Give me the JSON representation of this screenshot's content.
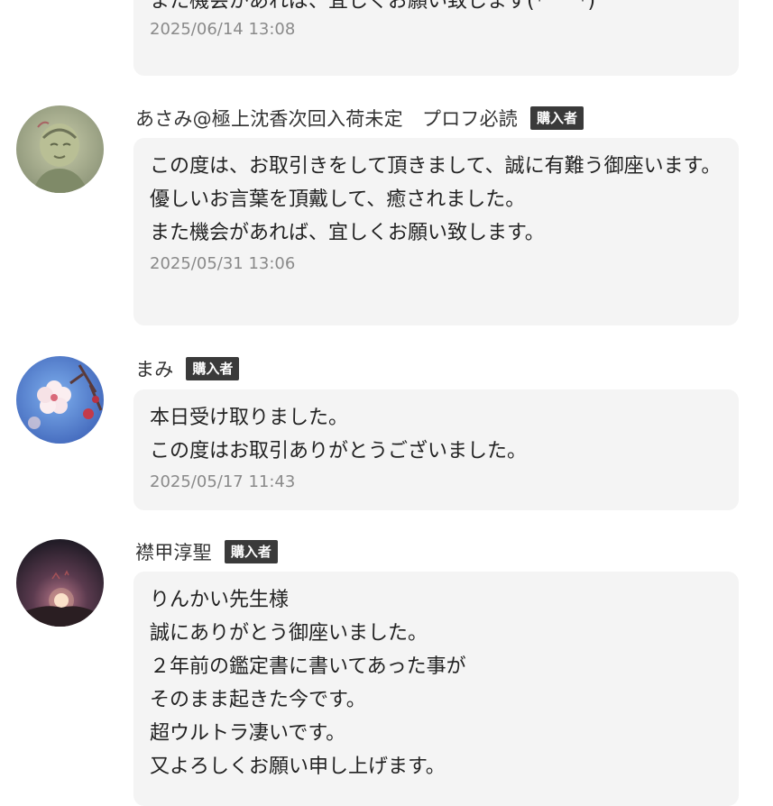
{
  "reviews": [
    {
      "message": "また機会があれば、宜しくお願い致します(*^^*)",
      "date": "2025/06/14 13:08"
    },
    {
      "name": "あさみ@極上沈香次回入荷未定　プロフ必読",
      "badge": "購入者",
      "avatar_icon": "user-avatar-icon",
      "message": "この度は、お取引きをして頂きまして、誠に有難う御座います。\n優しいお言葉を頂戴して、癒されました。\nまた機会があれば、宜しくお願い致します。",
      "date": "2025/05/31 13:06"
    },
    {
      "name": "まみ",
      "badge": "購入者",
      "avatar_icon": "plum-blossom-avatar-icon",
      "message": "本日受け取りました。\nこの度はお取引ありがとうございました。",
      "date": "2025/05/17 11:43"
    },
    {
      "name": "襟甲淳聖",
      "badge": "購入者",
      "avatar_icon": "sunset-mountain-avatar-icon",
      "message": "りんかい先生様\n誠にありがとう御座いました。\n２年前の鑑定書に書いてあった事が\nそのまま起きた今です。\n超ウルトラ凄いです。\n又よろしくお願い申し上げます。"
    }
  ],
  "colors": {
    "bubble_bg": "#f4f4f4",
    "badge_bg": "#3a3a3a",
    "date_text": "#8a8a8a"
  }
}
